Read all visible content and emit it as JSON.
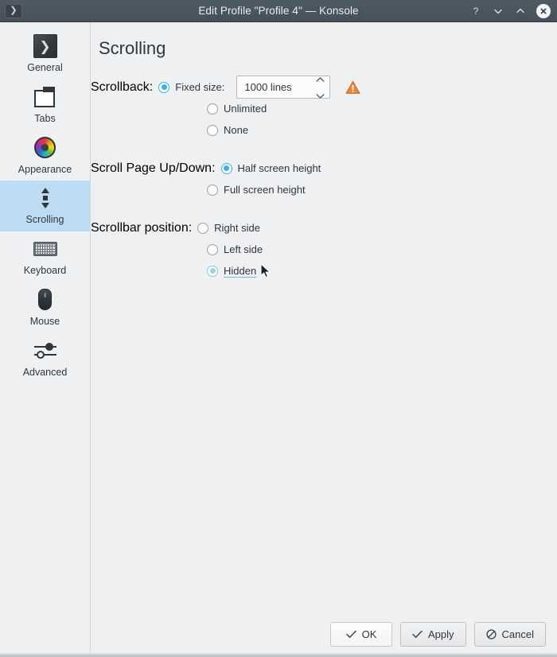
{
  "window": {
    "title": "Edit Profile \"Profile 4\" — Konsole",
    "app_icon": "konsole-icon",
    "buttons": {
      "help": "?",
      "minimize": "minimize-icon",
      "maximize": "maximize-icon",
      "close": "close-icon"
    }
  },
  "sidebar": {
    "items": [
      {
        "label": "General",
        "icon": "konsole-icon",
        "selected": false
      },
      {
        "label": "Tabs",
        "icon": "tabs-icon",
        "selected": false
      },
      {
        "label": "Appearance",
        "icon": "color-wheel-icon",
        "selected": false
      },
      {
        "label": "Scrolling",
        "icon": "scrollbar-icon",
        "selected": true
      },
      {
        "label": "Keyboard",
        "icon": "keyboard-icon",
        "selected": false
      },
      {
        "label": "Mouse",
        "icon": "mouse-icon",
        "selected": false
      },
      {
        "label": "Advanced",
        "icon": "sliders-icon",
        "selected": false
      }
    ]
  },
  "main": {
    "page_title": "Scrolling",
    "groups": [
      {
        "label": "Scrollback:",
        "name": "scrollback",
        "options": [
          {
            "label": "Fixed size:",
            "checked": true,
            "hovered": false
          },
          {
            "label": "Unlimited",
            "checked": false,
            "hovered": false
          },
          {
            "label": "None",
            "checked": false,
            "hovered": false
          }
        ]
      },
      {
        "label": "Scroll Page Up/Down:",
        "name": "scroll-page",
        "options": [
          {
            "label": "Half screen height",
            "checked": true,
            "hovered": false
          },
          {
            "label": "Full screen height",
            "checked": false,
            "hovered": false
          }
        ]
      },
      {
        "label": "Scrollbar position:",
        "name": "scrollbar-position",
        "options": [
          {
            "label": "Right side",
            "checked": false,
            "hovered": false
          },
          {
            "label": "Left side",
            "checked": false,
            "hovered": false
          },
          {
            "label": "Hidden",
            "checked": true,
            "hovered": true
          }
        ]
      }
    ],
    "scrollback_spinbox": {
      "value": "1000 lines",
      "placeholder": "1000 lines",
      "up_icon": "chevron-up-icon",
      "down_icon": "chevron-down-icon"
    },
    "warning_icon": "warning-triangle-icon"
  },
  "footer": {
    "buttons": [
      {
        "label": "OK",
        "icon": "check-icon",
        "default": true
      },
      {
        "label": "Apply",
        "icon": "check-icon",
        "default": false
      },
      {
        "label": "Cancel",
        "icon": "cancel-icon",
        "default": false
      }
    ]
  },
  "colors": {
    "titlebar": "#4a545e",
    "accent": "#3daee9",
    "selection": "#bcdcf4",
    "background": "#eff0f1",
    "text": "#31363b",
    "warning": "#e8863c"
  }
}
